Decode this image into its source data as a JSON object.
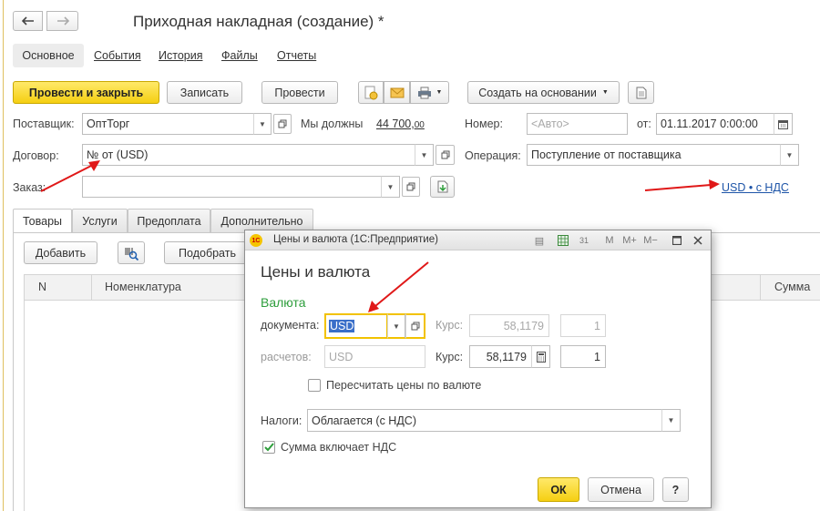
{
  "window": {
    "title": "Приходная накладная (создание) *",
    "nav_tabs": [
      "Основное",
      "События",
      "История",
      "Файлы",
      "Отчеты"
    ]
  },
  "toolbar": {
    "post_close": "Провести и закрыть",
    "save": "Записать",
    "post": "Провести",
    "create_based": "Создать на основании"
  },
  "form": {
    "supplier_label": "Поставщик:",
    "supplier_value": "ОптТорг",
    "we_owe_label": "Мы должны",
    "we_owe_amount": "44 700,",
    "we_owe_kopecks": "00",
    "number_label": "Номер:",
    "number_placeholder": "<Авто>",
    "date_from_label": "от:",
    "date_value": "01.11.2017  0:00:00",
    "contract_label": "Договор:",
    "contract_value": "№  от  (USD)",
    "operation_label": "Операция:",
    "operation_value": "Поступление от поставщика",
    "order_label": "Заказ:",
    "currency_link": "USD • с НДС"
  },
  "tabs": [
    "Товары",
    "Услуги",
    "Предоплата",
    "Дополнительно"
  ],
  "table": {
    "add_button": "Добавить",
    "pick_button": "Подобрать",
    "columns": [
      "N",
      "Номенклатура",
      "Сумма"
    ]
  },
  "dialog": {
    "window_title": "Цены и валюта (1С:Предприятие)",
    "header": "Цены и валюта",
    "group_currency": "Валюта",
    "doc_label": "документа:",
    "doc_currency": "USD",
    "rate_label": "Курс:",
    "doc_rate": "58,1179",
    "doc_multiplicity": "1",
    "settle_label": "расчетов:",
    "settle_currency": "USD",
    "settle_rate": "58,1179",
    "settle_multiplicity": "1",
    "recalc_label": "Пересчитать цены по валюте",
    "recalc_checked": false,
    "taxes_label": "Налоги:",
    "taxes_value": "Облагается (с НДС)",
    "vat_included_label": "Сумма включает НДС",
    "vat_included_checked": true,
    "ok": "ОК",
    "cancel": "Отмена",
    "help": "?"
  },
  "colors": {
    "accent_yellow": "#f5cf12",
    "link_blue": "#1e55a8",
    "group_green": "#2e9e3c",
    "annotation_red": "#e01818"
  }
}
